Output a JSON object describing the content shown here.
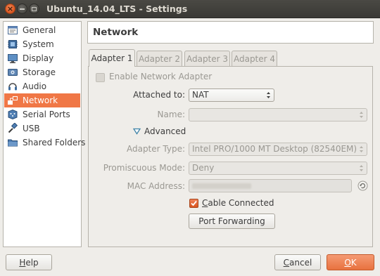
{
  "window": {
    "title": "Ubuntu_14.04_LTS - Settings",
    "close_glyph": "×"
  },
  "sidebar": {
    "items": [
      {
        "label": "General",
        "icon": "general-icon"
      },
      {
        "label": "System",
        "icon": "system-icon"
      },
      {
        "label": "Display",
        "icon": "display-icon"
      },
      {
        "label": "Storage",
        "icon": "storage-icon"
      },
      {
        "label": "Audio",
        "icon": "audio-icon"
      },
      {
        "label": "Network",
        "icon": "network-icon",
        "active": true
      },
      {
        "label": "Serial Ports",
        "icon": "serial-ports-icon"
      },
      {
        "label": "USB",
        "icon": "usb-icon"
      },
      {
        "label": "Shared Folders",
        "icon": "shared-folders-icon"
      }
    ]
  },
  "page": {
    "title": "Network"
  },
  "tabs": [
    {
      "label": "Adapter 1",
      "active": true
    },
    {
      "label": "Adapter 2"
    },
    {
      "label": "Adapter 3"
    },
    {
      "label": "Adapter 4"
    }
  ],
  "form": {
    "enable_adapter_label": "Enable Network Adapter",
    "attached_to_label": "Attached to:",
    "attached_to_value": "NAT",
    "name_label": "Name:",
    "name_value": "",
    "advanced_label": "Advanced",
    "adapter_type_label": "Adapter Type:",
    "adapter_type_value": "Intel PRO/1000 MT Desktop (82540EM)",
    "promiscuous_label": "Promiscuous Mode:",
    "promiscuous_value": "Deny",
    "mac_label": "MAC Address:",
    "mac_value": "",
    "cable_connected_label": "Cable Connected",
    "cable_connected_checked": true,
    "port_forwarding_label": "Port Forwarding"
  },
  "footer": {
    "help": "Help",
    "cancel": "Cancel",
    "ok": "OK"
  },
  "colors": {
    "accent": "#f07746",
    "titlebar": "#3c3b37",
    "background": "#efede9"
  }
}
